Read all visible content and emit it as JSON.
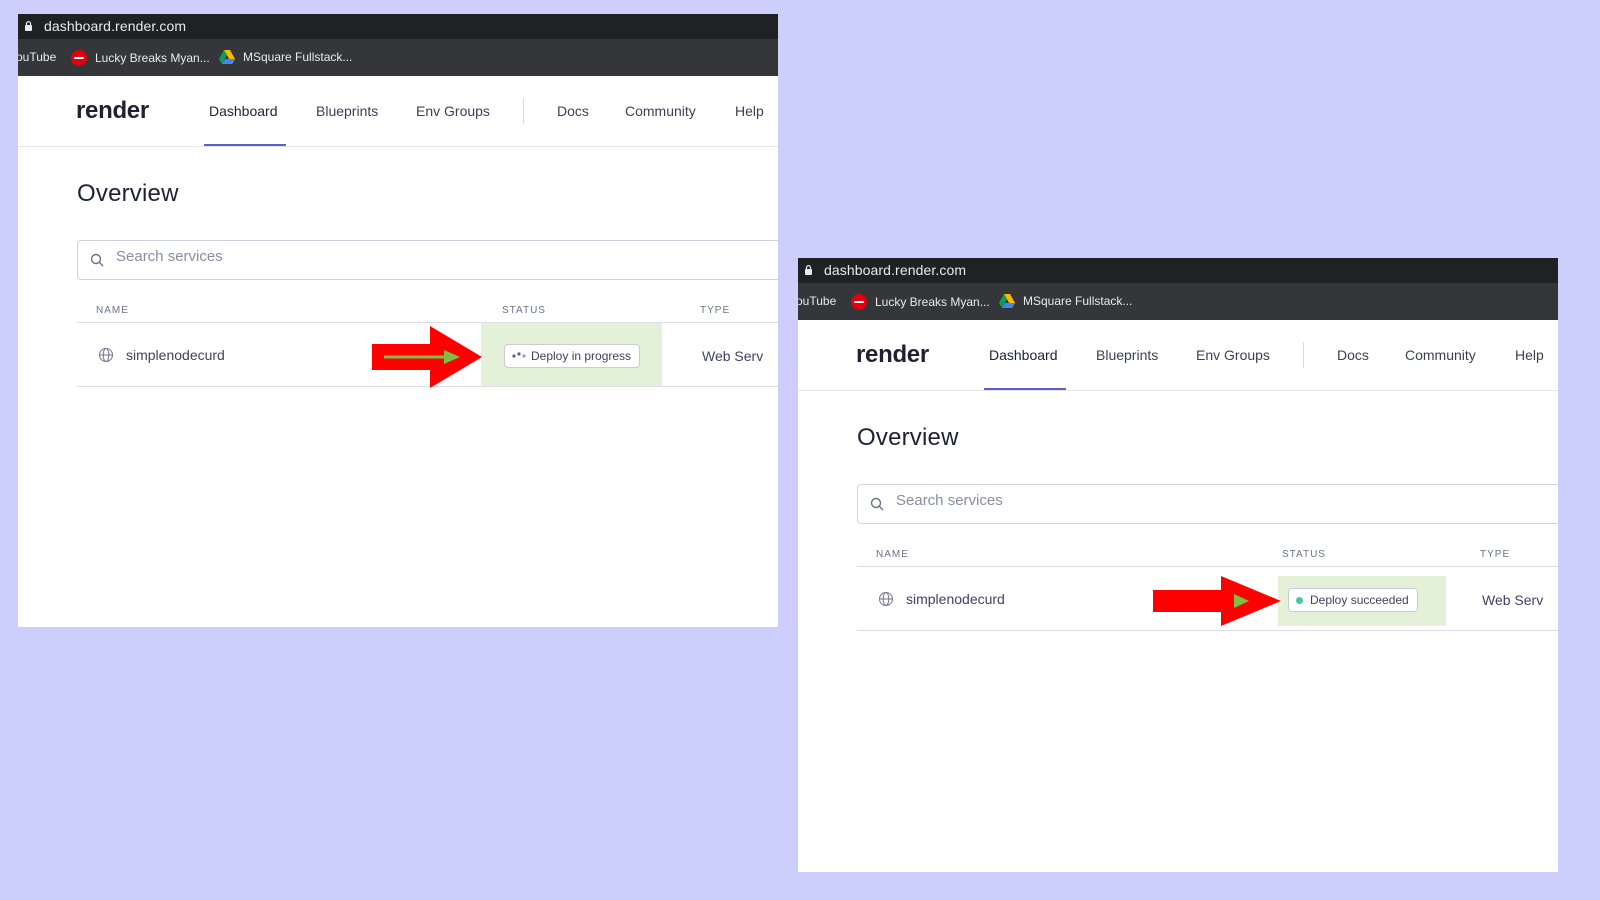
{
  "colors": {
    "background": "#cccefb",
    "nav_active_underline": "#5b5fc7",
    "status_highlight": "#e4f1d9",
    "arrow_red": "#ff0000",
    "arrow_green_overlay": "#7bc043",
    "success_dot": "#40c9a2"
  },
  "screenshots": [
    {
      "browser": {
        "url": "dashboard.render.com",
        "bookmarks": [
          {
            "label": "ouTube",
            "icon": "none"
          },
          {
            "label": "Lucky Breaks Myan...",
            "icon": "coca-cola-icon"
          },
          {
            "label": "MSquare Fullstack...",
            "icon": "google-drive-icon"
          }
        ]
      },
      "nav": {
        "logo": "render",
        "items": [
          "Dashboard",
          "Blueprints",
          "Env Groups",
          "Docs",
          "Community",
          "Help"
        ],
        "active": "Dashboard"
      },
      "page_title": "Overview",
      "search": {
        "placeholder": "Search services",
        "value": ""
      },
      "table": {
        "headers": [
          "NAME",
          "STATUS",
          "TYPE"
        ],
        "rows": [
          {
            "name": "simplenodecurd",
            "status": "Deploy in progress",
            "type": "Web Serv"
          }
        ]
      }
    },
    {
      "browser": {
        "url": "dashboard.render.com",
        "bookmarks": [
          {
            "label": "ouTube",
            "icon": "none"
          },
          {
            "label": "Lucky Breaks Myan...",
            "icon": "coca-cola-icon"
          },
          {
            "label": "MSquare Fullstack...",
            "icon": "google-drive-icon"
          }
        ]
      },
      "nav": {
        "logo": "render",
        "items": [
          "Dashboard",
          "Blueprints",
          "Env Groups",
          "Docs",
          "Community",
          "Help"
        ],
        "active": "Dashboard"
      },
      "page_title": "Overview",
      "search": {
        "placeholder": "Search services",
        "value": ""
      },
      "table": {
        "headers": [
          "NAME",
          "STATUS",
          "TYPE"
        ],
        "rows": [
          {
            "name": "simplenodecurd",
            "status": "Deploy succeeded",
            "type": "Web Serv"
          }
        ]
      }
    }
  ]
}
